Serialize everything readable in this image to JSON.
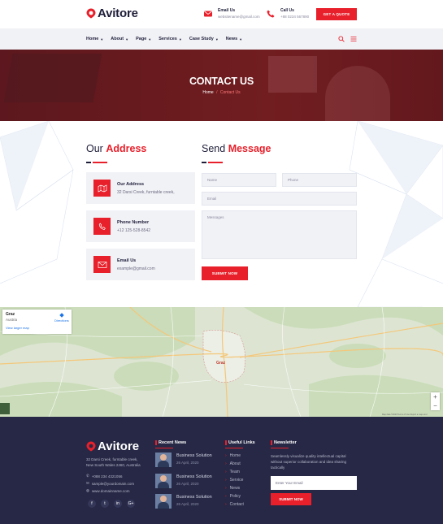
{
  "brand": {
    "name": "Avitore",
    "accent": "#e8202b",
    "dark": "#1e1e3a",
    "footer_bg": "#262845"
  },
  "header": {
    "email_label": "Email Us",
    "email_value": "websitename@gmail.com",
    "call_label": "Call Us",
    "call_value": "+88 0234 567890",
    "quote_button": "GET A QUOTE"
  },
  "nav": {
    "items": [
      {
        "label": "Home"
      },
      {
        "label": "About"
      },
      {
        "label": "Page"
      },
      {
        "label": "Services"
      },
      {
        "label": "Case Study"
      },
      {
        "label": "News"
      }
    ],
    "search_icon": "search-icon",
    "menu_icon": "hamburger-icon"
  },
  "hero": {
    "title": "CONTACT US",
    "breadcrumb_home": "Home",
    "breadcrumb_current": "Contact Us"
  },
  "address_section": {
    "title_plain": "Our",
    "title_highlight": "Address",
    "cards": [
      {
        "title": "Our Address",
        "text": "32 Darsi Creek, furntable creek,",
        "icon": "map-icon"
      },
      {
        "title": "Phone Number",
        "text": "+12 125-528-8542",
        "icon": "phone-icon"
      },
      {
        "title": "Email Us",
        "text": "example@gmail.com",
        "icon": "envelope-icon"
      }
    ]
  },
  "message_section": {
    "title_plain": "Send",
    "title_highlight": "Message",
    "name_placeholder": "Name",
    "phone_placeholder": "Phone",
    "email_placeholder": "Email",
    "messages_placeholder": "Messages",
    "submit": "SUBMIT NOW"
  },
  "map": {
    "place": "Graz",
    "region": "Austria",
    "larger_map": "View larger map",
    "directions": "Directions",
    "city_label": "Graz",
    "zoom_in": "+",
    "zoom_out": "−",
    "footer": "Map data ©2020  Terms of Use  Report a map error"
  },
  "footer": {
    "logo": "Avitore",
    "address_line1": "32 Darsi Creek, furntable creek,",
    "address_line2": "New South Wales 2460, Australia",
    "phone": "+088 234 4321056",
    "email": "sample@yourdomain.com",
    "website": "www.domainname.com",
    "social": [
      "f",
      "t",
      "in",
      "G+"
    ],
    "recent_news_title": "Recent News",
    "news": [
      {
        "title": "Business Solution",
        "date": "26 April, 2020"
      },
      {
        "title": "Business Solution",
        "date": "26 April, 2020"
      },
      {
        "title": "Business Solution",
        "date": "26 April, 2020"
      }
    ],
    "useful_links_title": "Useful Links",
    "links": [
      "Home",
      "About",
      "Team",
      "Service",
      "News",
      "Policy",
      "Contact"
    ],
    "newsletter_title": "Newsletter",
    "newsletter_text": "Seamlessly visualize quality intellectual capital without superior collaboration and idea sharing tactically",
    "newsletter_placeholder": "Enter Your Email",
    "newsletter_button": "SUBMIT NOW"
  }
}
